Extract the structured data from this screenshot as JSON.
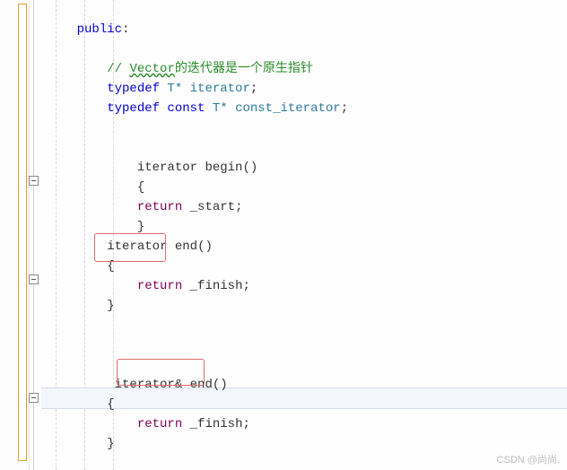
{
  "code": {
    "l1": "public",
    "l1b": ":",
    "blank": "",
    "l3a": "// ",
    "l3b": "Vector",
    "l3c": "的迭代器是一个原生指针",
    "l4_kw": "typedef",
    "l4_t": " T* ",
    "l4_name": "iterator",
    "l4_semi": ";",
    "l5_kw": "typedef",
    "l5_const": " const",
    "l5_t": " T* ",
    "l5_name": "const_iterator",
    "l5_semi": ";",
    "l7_ret": "iterator ",
    "l7_fn": "begin",
    "l7_par": "()",
    "lbrace": "{",
    "rbrace": "}",
    "l9_ret": "return",
    "l9_sp": " ",
    "l9_var": "_start",
    "l9_semi": ";",
    "l11_ret": "iterator ",
    "l11_fn": "end",
    "l11_par": "()",
    "l13_ret": "return",
    "l13_var": "_finish",
    "l13_semi": ";",
    "l16_ret": "iterator& ",
    "l16_fn": "end",
    "l16_par": "()",
    "l18_ret": "return",
    "l18_var": "_finish",
    "l18_semi": ";"
  },
  "watermark": "CSDN @尚尚."
}
